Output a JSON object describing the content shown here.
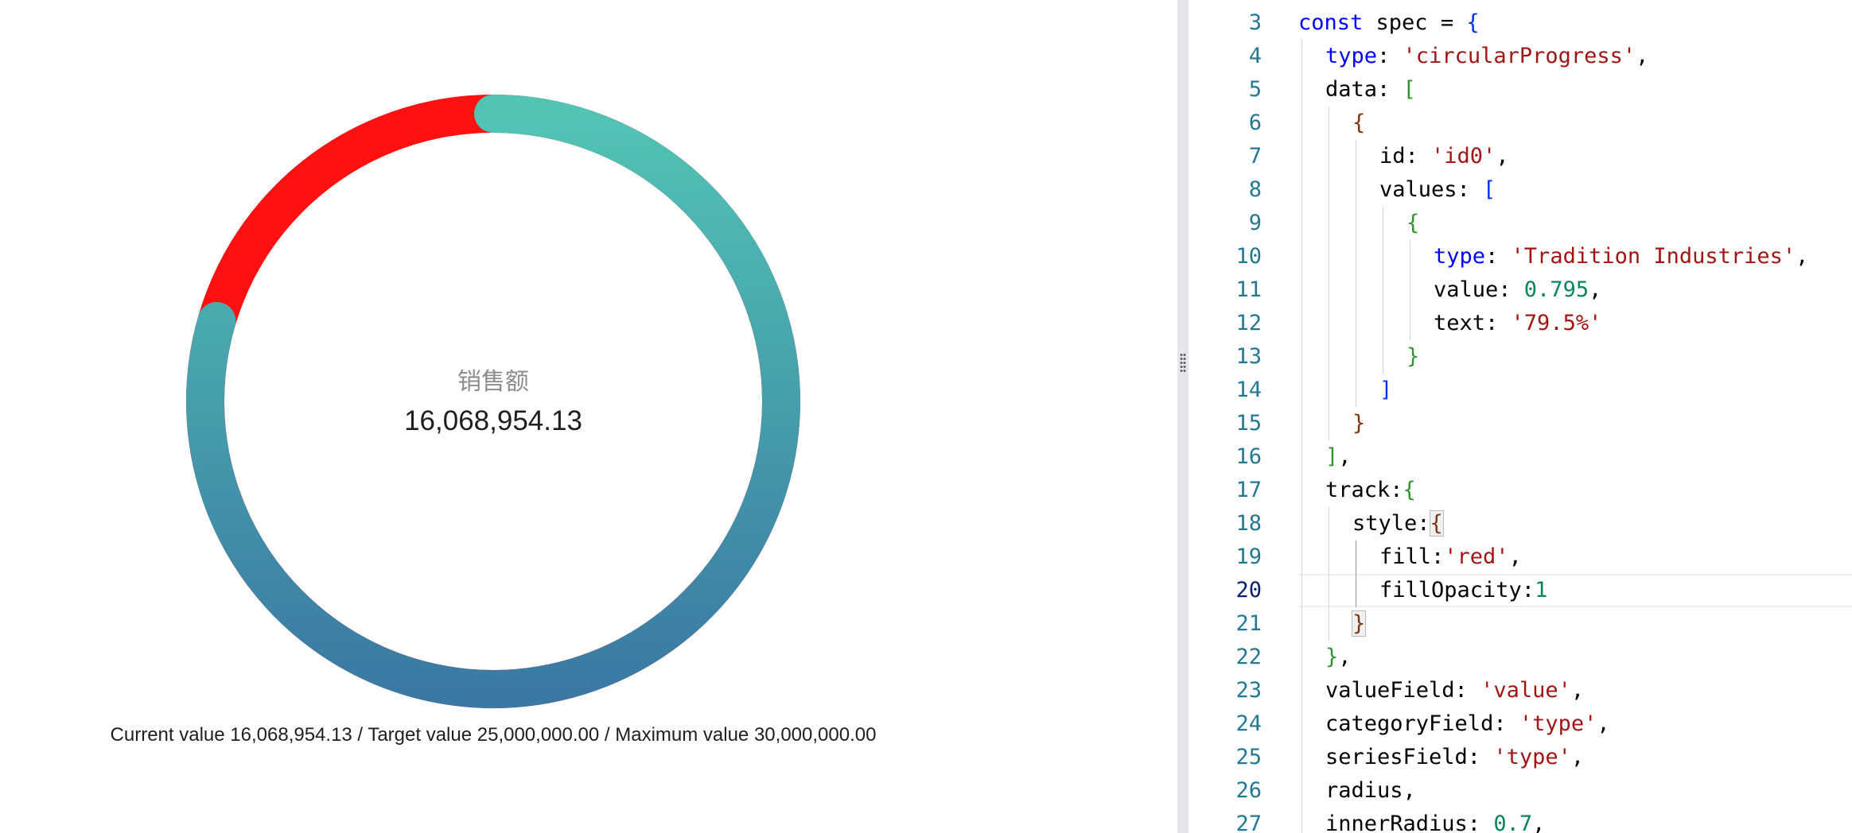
{
  "chart": {
    "center_label": "销售额",
    "center_value": "16,068,954.13",
    "footer": "Current value 16,068,954.13 / Target value 25,000,000.00 / Maximum value 30,000,000.00",
    "track_color": "#ff1111",
    "gradient_start": "#52c4b4",
    "gradient_end": "#3a79a3"
  },
  "chart_data": {
    "type": "circularProgress",
    "series": [
      {
        "name": "Tradition Industries",
        "value": 0.795,
        "text": "79.5%"
      }
    ],
    "range": [
      0,
      1
    ]
  },
  "editor": {
    "current_line": 20,
    "lines": [
      {
        "n": "3",
        "indent": 0,
        "tokens": [
          [
            "const",
            "tk-keyword"
          ],
          [
            " spec = ",
            "tk-punc"
          ],
          [
            "{",
            "tk-b1"
          ]
        ]
      },
      {
        "n": "4",
        "indent": 1,
        "tokens": [
          [
            "type",
            "tk-prop-blue"
          ],
          [
            ": ",
            "tk-punc"
          ],
          [
            "'circularProgress'",
            "tk-str"
          ],
          [
            ",",
            "tk-punc"
          ]
        ]
      },
      {
        "n": "5",
        "indent": 1,
        "tokens": [
          [
            "data: ",
            "tk-punc"
          ],
          [
            "[",
            "tk-b2"
          ]
        ]
      },
      {
        "n": "6",
        "indent": 2,
        "tokens": [
          [
            "{",
            "tk-b3"
          ]
        ]
      },
      {
        "n": "7",
        "indent": 3,
        "tokens": [
          [
            "id: ",
            "tk-punc"
          ],
          [
            "'id0'",
            "tk-str"
          ],
          [
            ",",
            "tk-punc"
          ]
        ]
      },
      {
        "n": "8",
        "indent": 3,
        "tokens": [
          [
            "values: ",
            "tk-punc"
          ],
          [
            "[",
            "tk-b1"
          ]
        ]
      },
      {
        "n": "9",
        "indent": 4,
        "tokens": [
          [
            "{",
            "tk-b2"
          ]
        ]
      },
      {
        "n": "10",
        "indent": 5,
        "tokens": [
          [
            "type",
            "tk-prop-blue"
          ],
          [
            ": ",
            "tk-punc"
          ],
          [
            "'Tradition Industries'",
            "tk-str"
          ],
          [
            ",",
            "tk-punc"
          ]
        ]
      },
      {
        "n": "11",
        "indent": 5,
        "tokens": [
          [
            "value: ",
            "tk-punc"
          ],
          [
            "0.795",
            "tk-num"
          ],
          [
            ",",
            "tk-punc"
          ]
        ]
      },
      {
        "n": "12",
        "indent": 5,
        "tokens": [
          [
            "text: ",
            "tk-punc"
          ],
          [
            "'79.5%'",
            "tk-str"
          ]
        ]
      },
      {
        "n": "13",
        "indent": 4,
        "tokens": [
          [
            "}",
            "tk-b2"
          ]
        ]
      },
      {
        "n": "14",
        "indent": 3,
        "tokens": [
          [
            "]",
            "tk-b1"
          ]
        ]
      },
      {
        "n": "15",
        "indent": 2,
        "tokens": [
          [
            "}",
            "tk-b3"
          ]
        ]
      },
      {
        "n": "16",
        "indent": 1,
        "tokens": [
          [
            "]",
            "tk-b2"
          ],
          [
            ",",
            "tk-punc"
          ]
        ]
      },
      {
        "n": "17",
        "indent": 1,
        "tokens": [
          [
            "track:",
            "tk-punc"
          ],
          [
            "{",
            "tk-b2"
          ]
        ]
      },
      {
        "n": "18",
        "indent": 2,
        "tokens": [
          [
            "style:",
            "tk-punc"
          ],
          [
            "{",
            "tk-b3 bracket-match"
          ]
        ]
      },
      {
        "n": "19",
        "indent": 3,
        "tokens": [
          [
            "fill:",
            "tk-punc"
          ],
          [
            "'red'",
            "tk-str"
          ],
          [
            ",",
            "tk-punc"
          ]
        ]
      },
      {
        "n": "20",
        "indent": 3,
        "tokens": [
          [
            "fillOpacity:",
            "tk-punc"
          ],
          [
            "1",
            "tk-num"
          ]
        ]
      },
      {
        "n": "21",
        "indent": 2,
        "tokens": [
          [
            "}",
            "tk-b3 bracket-match"
          ]
        ]
      },
      {
        "n": "22",
        "indent": 1,
        "tokens": [
          [
            "}",
            "tk-b2"
          ],
          [
            ",",
            "tk-punc"
          ]
        ]
      },
      {
        "n": "23",
        "indent": 1,
        "tokens": [
          [
            "valueField: ",
            "tk-punc"
          ],
          [
            "'value'",
            "tk-str"
          ],
          [
            ",",
            "tk-punc"
          ]
        ]
      },
      {
        "n": "24",
        "indent": 1,
        "tokens": [
          [
            "categoryField: ",
            "tk-punc"
          ],
          [
            "'type'",
            "tk-str"
          ],
          [
            ",",
            "tk-punc"
          ]
        ]
      },
      {
        "n": "25",
        "indent": 1,
        "tokens": [
          [
            "seriesField: ",
            "tk-punc"
          ],
          [
            "'type'",
            "tk-str"
          ],
          [
            ",",
            "tk-punc"
          ]
        ]
      },
      {
        "n": "26",
        "indent": 1,
        "tokens": [
          [
            "radius,",
            "tk-punc"
          ]
        ]
      },
      {
        "n": "27",
        "indent": 1,
        "tokens": [
          [
            "innerRadius: ",
            "tk-punc"
          ],
          [
            "0.7",
            "tk-num"
          ],
          [
            ",",
            "tk-punc"
          ]
        ]
      }
    ]
  }
}
